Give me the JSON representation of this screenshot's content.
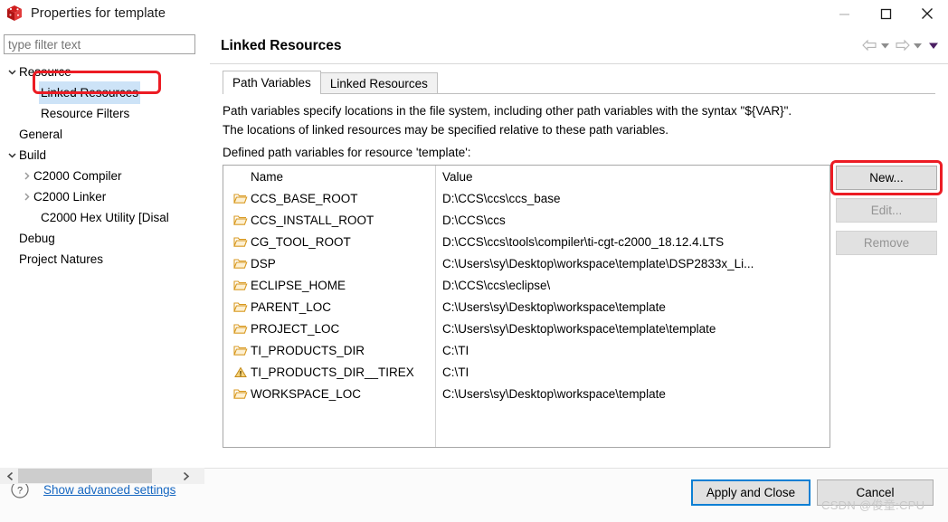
{
  "window": {
    "title": "Properties for template",
    "icon": "ccs-cube-icon",
    "controls": [
      {
        "name": "minimize-button",
        "glyph": "minimize-icon"
      },
      {
        "name": "maximize-button",
        "glyph": "maximize-icon"
      },
      {
        "name": "close-button",
        "glyph": "close-icon"
      }
    ]
  },
  "sidebar": {
    "filter": {
      "value": "",
      "placeholder": "type filter text"
    },
    "items": [
      {
        "label": "Resource",
        "indent": 0,
        "twisty": "expanded",
        "selected": false
      },
      {
        "label": "Linked Resources",
        "indent": 1,
        "twisty": "none",
        "selected": true
      },
      {
        "label": "Resource Filters",
        "indent": 1,
        "twisty": "none",
        "selected": false
      },
      {
        "label": "General",
        "indent": 0,
        "twisty": "none",
        "selected": false
      },
      {
        "label": "Build",
        "indent": 0,
        "twisty": "expanded",
        "selected": false
      },
      {
        "label": "C2000 Compiler",
        "indent": 1,
        "twisty": "collapsed",
        "selected": false
      },
      {
        "label": "C2000 Linker",
        "indent": 1,
        "twisty": "collapsed",
        "selected": false
      },
      {
        "label": "C2000 Hex Utility  [Disal",
        "indent": 1,
        "twisty": "none",
        "selected": false
      },
      {
        "label": "Debug",
        "indent": 0,
        "twisty": "none",
        "selected": false
      },
      {
        "label": "Project Natures",
        "indent": 0,
        "twisty": "none",
        "selected": false
      }
    ],
    "hscroll": {
      "left_arrow": "chevron-left-icon",
      "right_arrow": "chevron-right-icon"
    }
  },
  "page": {
    "title": "Linked Resources",
    "nav": [
      {
        "name": "back-arrow-icon"
      },
      {
        "name": "back-dropdown-icon"
      },
      {
        "name": "forward-arrow-icon"
      },
      {
        "name": "forward-dropdown-icon"
      },
      {
        "name": "view-menu-icon"
      }
    ],
    "tabs": [
      {
        "label": "Path Variables",
        "active": true
      },
      {
        "label": "Linked Resources",
        "active": false
      }
    ],
    "description": [
      "Path variables specify locations in the file system, including other path variables with the syntax \"${VAR}\".",
      "The locations of linked resources may be specified relative to these path variables."
    ],
    "list_label": "Defined path variables for resource 'template':"
  },
  "table": {
    "columns": [
      "Name",
      "Value"
    ],
    "rows": [
      {
        "icon": "folder-icon",
        "name": "CCS_BASE_ROOT",
        "value": "D:\\CCS\\ccs\\ccs_base"
      },
      {
        "icon": "folder-icon",
        "name": "CCS_INSTALL_ROOT",
        "value": "D:\\CCS\\ccs"
      },
      {
        "icon": "folder-icon",
        "name": "CG_TOOL_ROOT",
        "value": "D:\\CCS\\ccs\\tools\\compiler\\ti-cgt-c2000_18.12.4.LTS"
      },
      {
        "icon": "folder-icon",
        "name": "DSP",
        "value": "C:\\Users\\sy\\Desktop\\workspace\\template\\DSP2833x_Li..."
      },
      {
        "icon": "folder-icon",
        "name": "ECLIPSE_HOME",
        "value": "D:\\CCS\\ccs\\eclipse\\"
      },
      {
        "icon": "folder-icon",
        "name": "PARENT_LOC",
        "value": "C:\\Users\\sy\\Desktop\\workspace\\template"
      },
      {
        "icon": "folder-icon",
        "name": "PROJECT_LOC",
        "value": "C:\\Users\\sy\\Desktop\\workspace\\template\\template"
      },
      {
        "icon": "folder-icon",
        "name": "TI_PRODUCTS_DIR",
        "value": "C:\\TI"
      },
      {
        "icon": "warning-icon",
        "name": "TI_PRODUCTS_DIR__TIREX",
        "value": "C:\\TI"
      },
      {
        "icon": "folder-icon",
        "name": "WORKSPACE_LOC",
        "value": "C:\\Users\\sy\\Desktop\\workspace\\template"
      }
    ]
  },
  "side_buttons": [
    {
      "label": "New...",
      "enabled": true
    },
    {
      "label": "Edit...",
      "enabled": false
    },
    {
      "label": "Remove",
      "enabled": false
    }
  ],
  "footer": {
    "help_icon": "question-mark-icon",
    "advanced_link": "Show advanced settings",
    "apply_label": "Apply and Close",
    "cancel_label": "Cancel",
    "watermark": "CSDN @俊童:CPU"
  },
  "annotations": {
    "highlight_color": "#ec1c24",
    "selection_color": "#cde3f7",
    "focus_color": "#0b7fd4",
    "link_color": "#1667c1"
  }
}
